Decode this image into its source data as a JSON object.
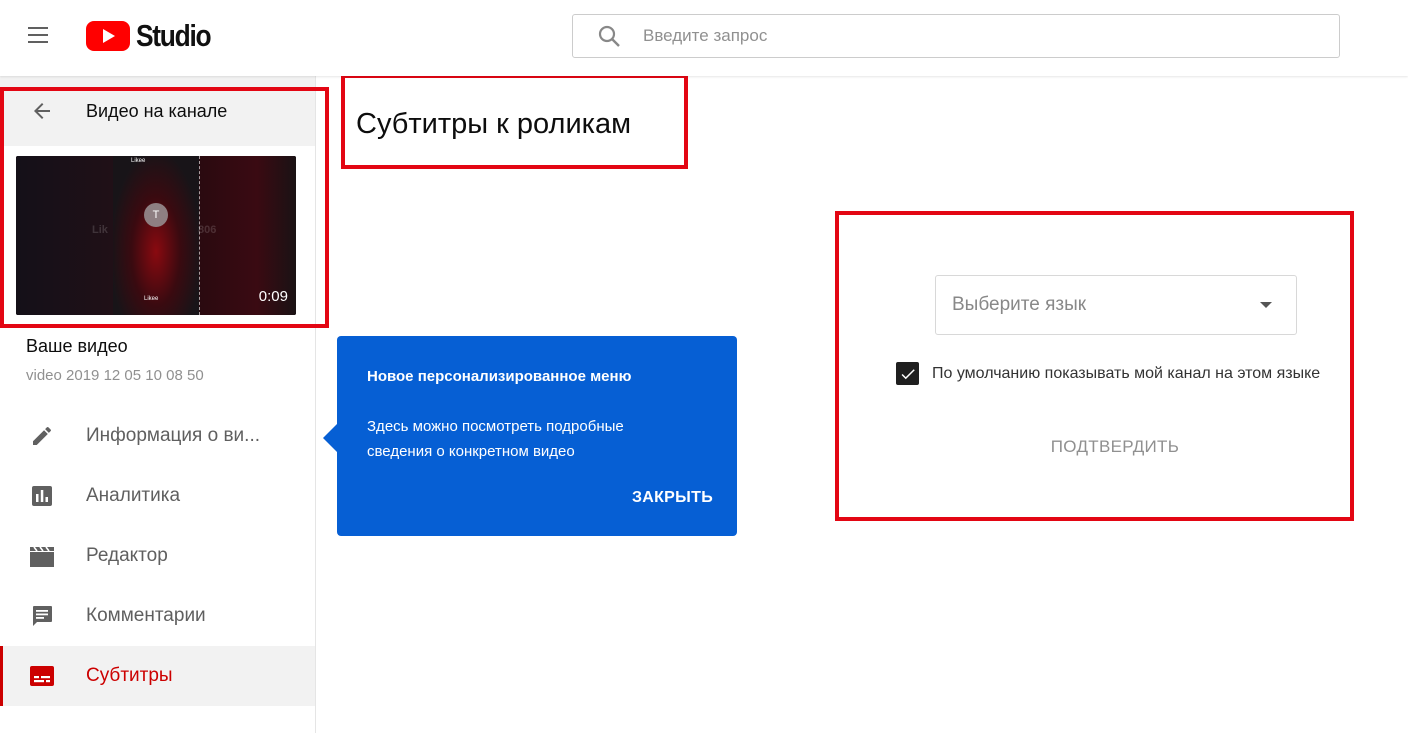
{
  "header": {
    "logo_text": "Studio",
    "search_placeholder": "Введите запрос"
  },
  "sidebar": {
    "back_label": "Видео на канале",
    "video": {
      "duration": "0:09",
      "title": "Ваше видео",
      "subtitle": "video 2019 12 05 10 08 50",
      "thumb_brand": "Likee",
      "thumb_avatar_letter": "T",
      "thumb_ghost_left": "Lik",
      "thumb_ghost_right": "806"
    },
    "menu": [
      {
        "label": "Информация о ви...",
        "icon": "pencil-icon",
        "active": false
      },
      {
        "label": "Аналитика",
        "icon": "analytics-icon",
        "active": false
      },
      {
        "label": "Редактор",
        "icon": "clapperboard-icon",
        "active": false
      },
      {
        "label": "Комментарии",
        "icon": "comment-icon",
        "active": false
      },
      {
        "label": "Субтитры",
        "icon": "subtitles-icon",
        "active": true
      }
    ]
  },
  "main": {
    "title": "Субтитры к роликам"
  },
  "tooltip": {
    "title": "Новое персонализированное меню",
    "body": "Здесь можно посмотреть подробные сведения о конкретном видео",
    "close_label": "ЗАКРЫТЬ"
  },
  "language_panel": {
    "select_placeholder": "Выберите язык",
    "checkbox_label": "По умолчанию показывать мой канал на этом языке",
    "checkbox_checked": true,
    "confirm_label": "ПОДТВЕРДИТЬ"
  },
  "colors": {
    "brand_red": "#ff0000",
    "active_red": "#cc0000",
    "tooltip_blue": "#065fd4",
    "annotation_red": "#e30613"
  }
}
